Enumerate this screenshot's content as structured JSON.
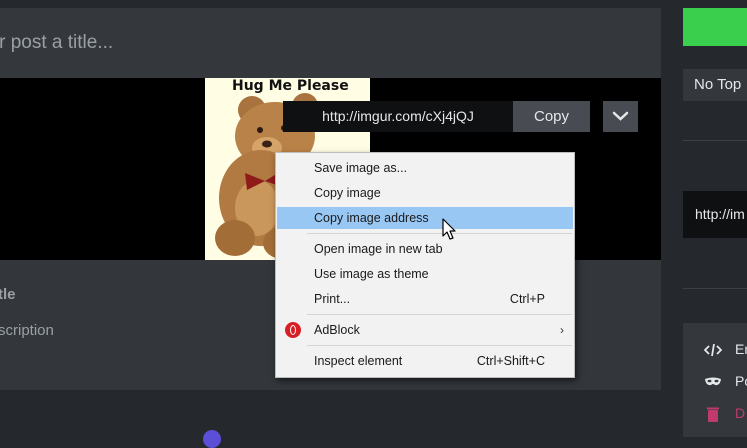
{
  "editor": {
    "title_placeholder": "our post a title...",
    "image_caption": "Hug Me Please",
    "desc_title_placeholder": "tle",
    "desc_description_placeholder": "scription"
  },
  "image_link": {
    "url": "http://imgur.com/cXj4jQJ",
    "copy_label": "Copy",
    "dropdown_icon": "chevron-down-icon"
  },
  "context_menu": {
    "items": [
      {
        "label": "Save image as...",
        "shortcut": ""
      },
      {
        "label": "Copy image",
        "shortcut": ""
      },
      {
        "label": "Copy image address",
        "shortcut": "",
        "highlighted": true
      },
      {
        "label": "Open image in new tab",
        "shortcut": ""
      },
      {
        "label": "Use image as theme",
        "shortcut": ""
      },
      {
        "label": "Print...",
        "shortcut": "Ctrl+P"
      },
      {
        "label": "AdBlock",
        "shortcut": "",
        "submenu_icon": "chevron-right-icon"
      },
      {
        "label": "Inspect element",
        "shortcut": "Ctrl+Shift+C"
      }
    ],
    "highlight_color": "#99c7f4"
  },
  "sidebar": {
    "topic_select_value": "No Top",
    "share_url": "http://im",
    "options": [
      {
        "icon": "code-icon",
        "label": "En"
      },
      {
        "icon": "mask-icon",
        "label": "Po"
      },
      {
        "icon": "trash-icon",
        "label": "D"
      }
    ],
    "publish_color": "#3bcf4e"
  }
}
